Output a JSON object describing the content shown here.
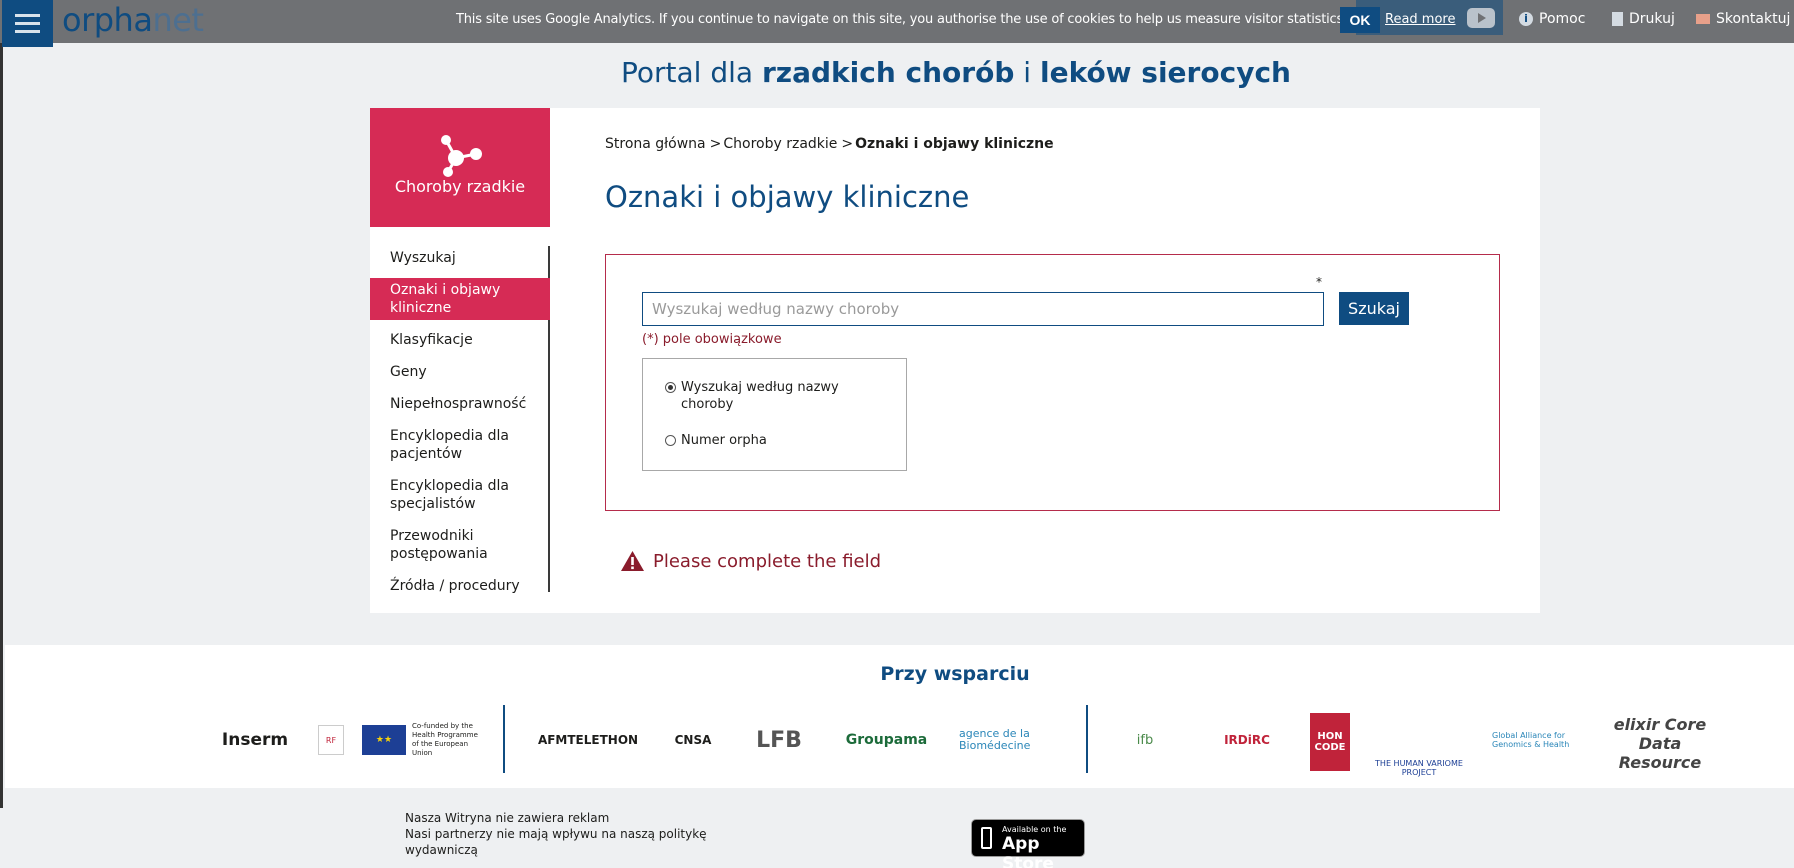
{
  "topbar": {
    "logo_main": "orpha",
    "logo_suffix": "net",
    "cookie_text": "This site uses Google Analytics. If you continue to navigate on this site, you authorise the use of cookies to help us measure visitor statistics.",
    "ok_label": "OK",
    "read_more_label": "Read more",
    "links": {
      "help": "Pomoc",
      "print": "Drukuj",
      "contact": "Skontaktuj s"
    }
  },
  "portal": {
    "title_prefix": "Portal dla ",
    "title_bold1": "rzadkich chorób",
    "title_mid": " i ",
    "title_bold2": "leków sierocych"
  },
  "category": {
    "label": "Choroby rzadkie"
  },
  "sidebar": {
    "items": [
      {
        "label": "Wyszukaj"
      },
      {
        "label": "Oznaki i objawy kliniczne"
      },
      {
        "label": "Klasyfikacje"
      },
      {
        "label": "Geny"
      },
      {
        "label": "Niepełnosprawność"
      },
      {
        "label": "Encyklopedia dla pacjentów"
      },
      {
        "label": "Encyklopedia dla specjalistów"
      },
      {
        "label": "Przewodniki postępowania"
      },
      {
        "label": "Źródła / procedury"
      }
    ]
  },
  "breadcrumb": {
    "home": "Strona główna",
    "section": "Choroby rzadkie",
    "current": "Oznaki i objawy kliniczne",
    "separator": ">"
  },
  "main": {
    "title": "Oznaki i objawy kliniczne",
    "search": {
      "placeholder": "Wyszukaj według nazwy choroby",
      "value": "",
      "required_star": "*",
      "button_label": "Szukaj",
      "required_note": "(*) pole obowiązkowe",
      "options": [
        {
          "label": "Wyszukaj według nazwy choroby",
          "checked": true
        },
        {
          "label": "Numer orpha",
          "checked": false
        }
      ]
    },
    "alert": "Please complete the field"
  },
  "sponsors": {
    "title": "Przy wsparciu",
    "logos": [
      {
        "name": "Inserm"
      },
      {
        "name": "RF"
      },
      {
        "name": "Co-funded by the Health Programme of the European Union"
      },
      {
        "name": "AFMTELETHON"
      },
      {
        "name": "CNSA"
      },
      {
        "name": "LFB"
      },
      {
        "name": "Groupama"
      },
      {
        "name": "agence de la Biomédecine"
      },
      {
        "name": "ifb"
      },
      {
        "name": "IRDiRC"
      },
      {
        "name": "HON CODE"
      },
      {
        "name": "THE HUMAN VARIOME PROJECT"
      },
      {
        "name": "Global Alliance for Genomics & Health"
      },
      {
        "name": "elixir Core Data Resource"
      }
    ]
  },
  "footer": {
    "line1": "Nasza Witryna nie zawiera reklam",
    "line2": "Nasi partnerzy nie mają wpływu na naszą politykę wydawniczą",
    "appstore_small": "Available on the",
    "appstore_big": "App Store"
  },
  "colors": {
    "brand_blue": "#0f4c81",
    "accent_pink": "#d62b55",
    "error_red": "#8a1c2c",
    "topbar_gray": "#6f7174"
  }
}
